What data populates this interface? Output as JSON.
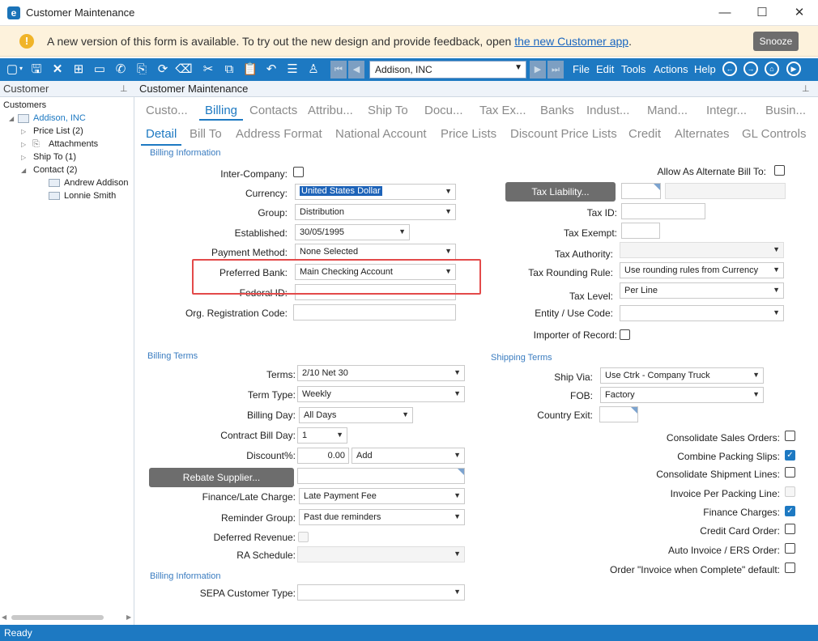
{
  "window": {
    "title": "Customer Maintenance",
    "app_icon": "e",
    "minimize": "—",
    "maximize": "☐",
    "close": "✕"
  },
  "banner": {
    "text": "A new version of this form is available. To try out the new design and provide feedback, open ",
    "link": "the new Customer app",
    "after": ".",
    "snooze": "Snooze",
    "icon": "!"
  },
  "toolbar": {
    "nav_value": "Addison, INC",
    "menus": [
      "File",
      "Edit",
      "Tools",
      "Actions",
      "Help"
    ]
  },
  "left": {
    "title": "Customer",
    "tree": {
      "root": "Customers",
      "customer": "Addison, INC",
      "price_list": "Price List (2)",
      "attachments": "Attachments",
      "ship_to": "Ship To (1)",
      "contact": "Contact (2)",
      "contact1": "Andrew Addison",
      "contact2": "Lonnie Smith"
    }
  },
  "right": {
    "title": "Customer Maintenance",
    "tabs1": [
      "Custo...",
      "Billing",
      "Contacts",
      "Attribu...",
      "Ship To",
      "Docu...",
      "Tax Ex...",
      "Banks",
      "Indust...",
      "Mand...",
      "Integr...",
      "Busin..."
    ],
    "tabs2": [
      "Detail",
      "Bill To",
      "Address Format",
      "National Account",
      "Price Lists",
      "Discount Price Lists",
      "Credit",
      "Alternates",
      "GL Controls"
    ]
  },
  "billing_info": {
    "section": "Billing Information",
    "inter_company": "Inter-Company:",
    "currency_label": "Currency:",
    "currency_value": "United States Dollar",
    "group_label": "Group:",
    "group_value": "Distribution",
    "established_label": "Established:",
    "established_value": "30/05/1995",
    "payment_label": "Payment Method:",
    "payment_value": "None Selected",
    "bank_label": "Preferred Bank:",
    "bank_value": "Main Checking Account",
    "federal_label": "Federal ID:",
    "org_label": "Org. Registration Code:"
  },
  "tax": {
    "alt_bill": "Allow As Alternate Bill To:",
    "tax_liability": "Tax Liability...",
    "tax_id": "Tax ID:",
    "tax_exempt": "Tax Exempt:",
    "tax_authority": "Tax Authority:",
    "rounding_label": "Tax Rounding Rule:",
    "rounding_value": "Use rounding rules from Currency",
    "level_label": "Tax Level:",
    "level_value": "Per Line",
    "entity_label": "Entity / Use Code:",
    "importer": "Importer of Record:"
  },
  "billing_terms": {
    "section": "Billing Terms",
    "terms_label": "Terms:",
    "terms_value": "2/10 Net 30",
    "term_type_label": "Term Type:",
    "term_type_value": "Weekly",
    "billing_day_label": "Billing Day:",
    "billing_day_value": "All Days",
    "contract_label": "Contract Bill Day:",
    "contract_value": "1",
    "discount_label": "Discount%:",
    "discount_value": "0.00",
    "discount_mode": "Add",
    "rebate": "Rebate Supplier...",
    "finance_label": "Finance/Late Charge:",
    "finance_value": "Late Payment Fee",
    "reminder_label": "Reminder Group:",
    "reminder_value": "Past due reminders",
    "deferred": "Deferred Revenue:",
    "ra_label": "RA Schedule:"
  },
  "shipping": {
    "section": "Shipping Terms",
    "ship_via_label": "Ship Via:",
    "ship_via_value": "Use Ctrk - Company Truck",
    "fob_label": "FOB:",
    "fob_value": "Factory",
    "country_exit": "Country Exit:"
  },
  "options": {
    "consolidate_sales": "Consolidate Sales Orders:",
    "combine_packing": "Combine Packing Slips:",
    "consolidate_shipment": "Consolidate Shipment Lines:",
    "invoice_per_packing": "Invoice Per Packing Line:",
    "finance_charges": "Finance Charges:",
    "credit_card": "Credit Card Order:",
    "auto_invoice": "Auto Invoice / ERS Order:",
    "order_invoice": "Order \"Invoice when Complete\" default:"
  },
  "billing_info2": {
    "section": "Billing Information",
    "sepa_label": "SEPA Customer Type:"
  },
  "status": {
    "text": "Ready"
  },
  "colors": {
    "accent": "#1d79c2",
    "highlight": "#e34a4a",
    "banner": "#fdf2dc"
  }
}
